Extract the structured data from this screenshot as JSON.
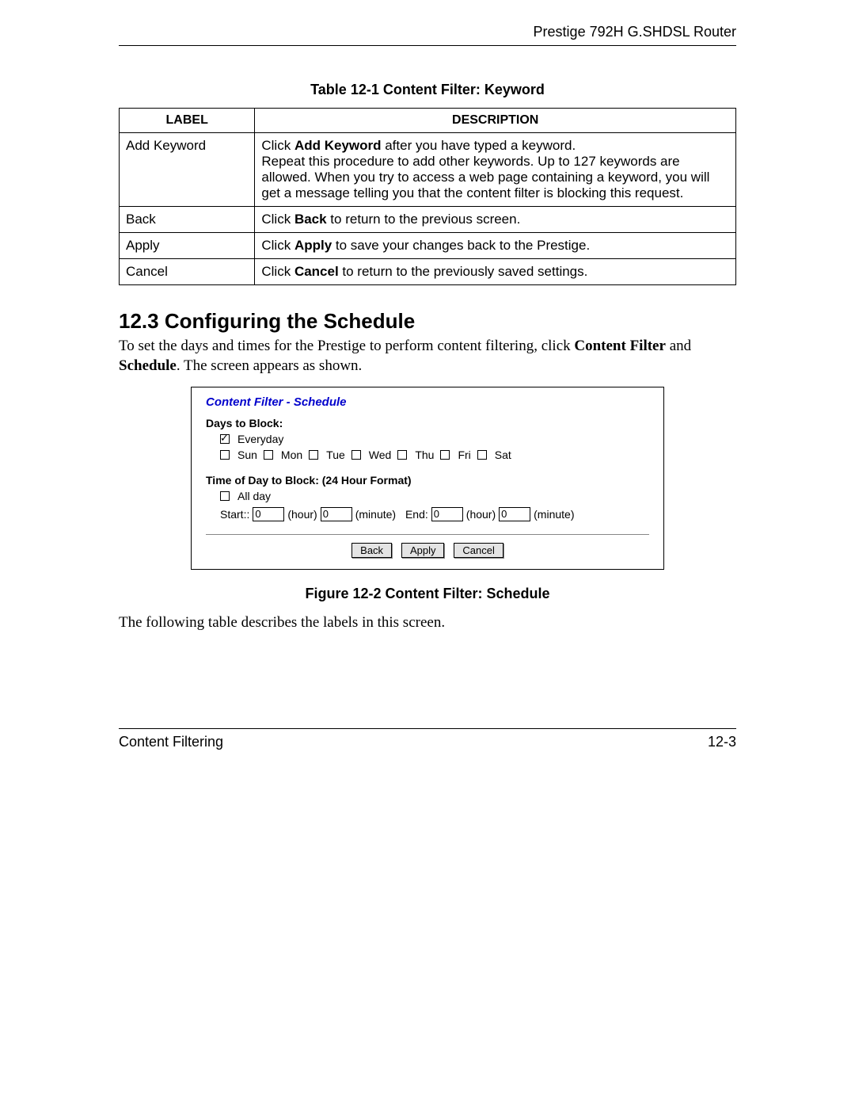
{
  "header": {
    "product": "Prestige 792H G.SHDSL Router"
  },
  "table_caption": "Table 12-1 Content Filter: Keyword",
  "table": {
    "headers": {
      "label": "LABEL",
      "description": "DESCRIPTION"
    },
    "rows": [
      {
        "label": "Add Keyword",
        "desc_pre": "Click ",
        "desc_bold": "Add Keyword",
        "desc_post": " after you have typed a keyword.\nRepeat this procedure to add other keywords. Up to 127 keywords are allowed. When you try to access a web page containing a keyword, you will get a message telling you that the content filter is blocking this request."
      },
      {
        "label": "Back",
        "desc_pre": "Click ",
        "desc_bold": "Back",
        "desc_post": " to return to the previous screen."
      },
      {
        "label": "Apply",
        "desc_pre": "Click ",
        "desc_bold": "Apply",
        "desc_post": " to save your changes back to the Prestige."
      },
      {
        "label": "Cancel",
        "desc_pre": "Click ",
        "desc_bold": "Cancel",
        "desc_post": " to return to the previously saved settings."
      }
    ]
  },
  "section": {
    "heading": "12.3  Configuring the Schedule",
    "intro_pre": "To set the days and times for the Prestige to perform content filtering, click ",
    "intro_b1": "Content Filter",
    "intro_mid": " and ",
    "intro_b2": "Schedule",
    "intro_post": ". The screen appears as shown."
  },
  "panel": {
    "title": "Content Filter - Schedule",
    "days_label": "Days to Block:",
    "everyday": "Everyday",
    "days": {
      "sun": "Sun",
      "mon": "Mon",
      "tue": "Tue",
      "wed": "Wed",
      "thu": "Thu",
      "fri": "Fri",
      "sat": "Sat"
    },
    "time_label": "Time of Day to Block: (24 Hour Format)",
    "allday": "All day",
    "start_label": "Start::",
    "hour": "(hour)",
    "minute": "(minute)",
    "end_label": "End:",
    "val_start_h": "0",
    "val_start_m": "0",
    "val_end_h": "0",
    "val_end_m": "0",
    "buttons": {
      "back": "Back",
      "apply": "Apply",
      "cancel": "Cancel"
    }
  },
  "figure_caption": "Figure 12-2 Content Filter: Schedule",
  "following_text": "The following table describes the labels in this screen.",
  "footer": {
    "left": "Content Filtering",
    "right": "12-3"
  }
}
